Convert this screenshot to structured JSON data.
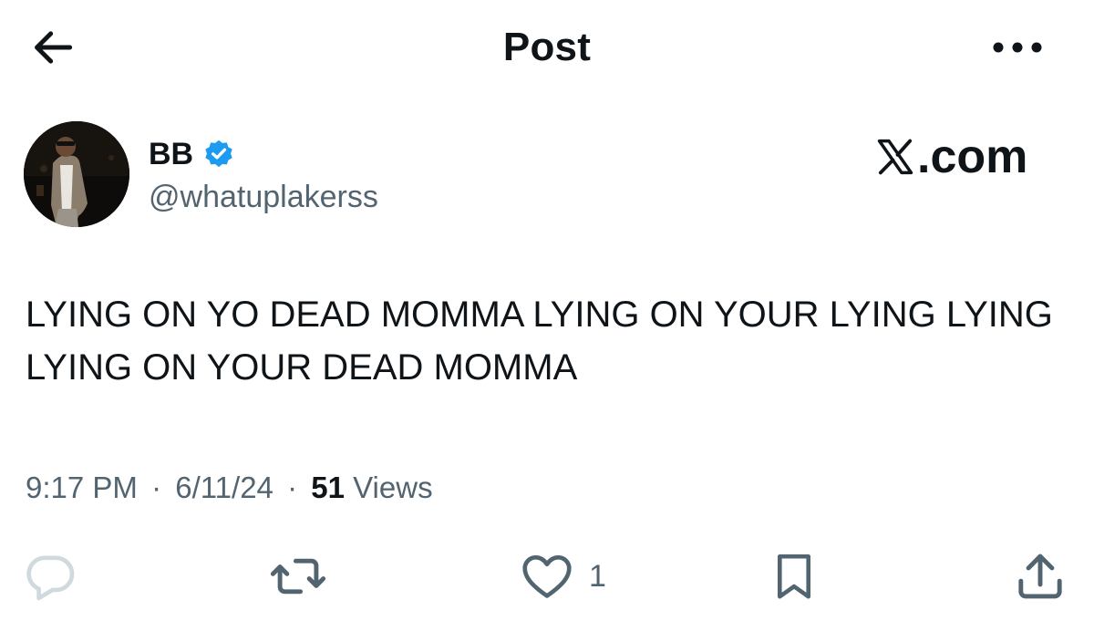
{
  "header": {
    "title": "Post",
    "back_icon": "arrow-left-icon",
    "more_icon": "more-horizontal-icon"
  },
  "author": {
    "name": "BB",
    "handle": "@whatuplakerss",
    "verified": true,
    "verified_color": "#1d9bf0"
  },
  "watermark": {
    "logo_icon": "x-logo-icon",
    "text": ".com"
  },
  "post": {
    "text": "LYING ON YO DEAD MOMMA LYING ON YOUR LYING LYING LYING ON YOUR DEAD MOMMA"
  },
  "meta": {
    "time": "9:17 PM",
    "separator": "·",
    "date": "6/11/24",
    "views_count": "51",
    "views_label": "Views"
  },
  "actions": {
    "reply_icon": "reply-icon",
    "repost_icon": "repost-icon",
    "like_icon": "heart-icon",
    "like_count": "1",
    "bookmark_icon": "bookmark-icon",
    "share_icon": "share-icon"
  },
  "colors": {
    "text": "#0f1419",
    "secondary_text": "#536471",
    "accent": "#1d9bf0",
    "disabled_icon": "#cfd9de"
  }
}
